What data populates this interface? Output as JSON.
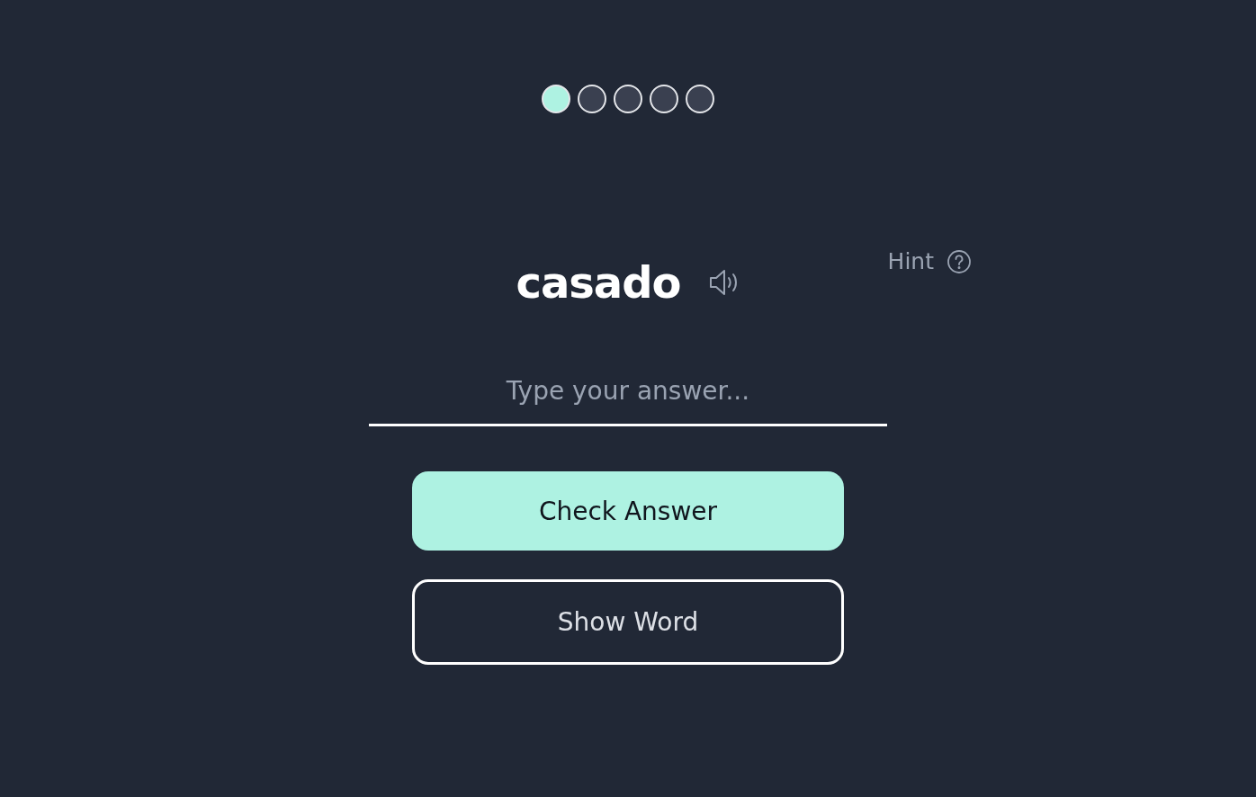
{
  "progress": [
    {
      "selected": true
    },
    {
      "selected": false
    },
    {
      "selected": false
    },
    {
      "selected": false
    },
    {
      "selected": false
    }
  ],
  "word": "casado",
  "hint": {
    "label": "Hint"
  },
  "answer": {
    "placeholder": "Type your answer..."
  },
  "buttons": [
    {
      "kind": "primary",
      "label": "Check Answer"
    },
    {
      "kind": "outline",
      "label": "Show Word"
    }
  ]
}
